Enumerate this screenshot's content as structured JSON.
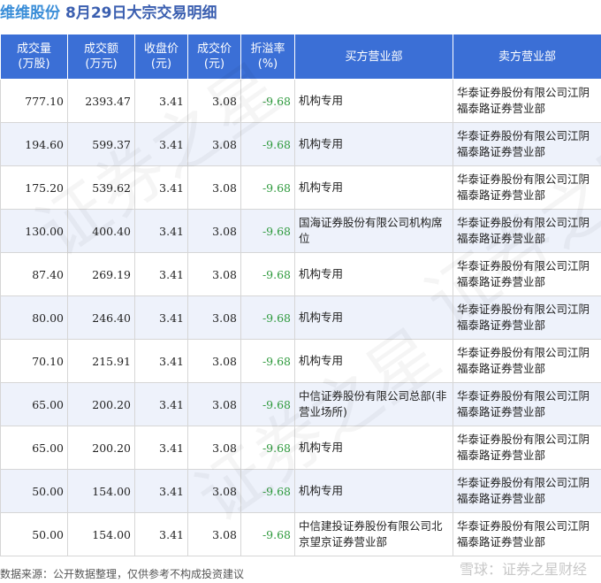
{
  "header": {
    "stock_name": "维维股份",
    "subtitle": "8月29日大宗交易明细"
  },
  "table": {
    "headers": {
      "volume": [
        "成交量",
        "(万股)"
      ],
      "amount": [
        "成交额",
        "(万元)"
      ],
      "close": [
        "收盘价",
        "(元)"
      ],
      "price": [
        "成交价",
        "(元)"
      ],
      "premium": [
        "折溢率",
        "(%)"
      ],
      "buyer": "买方营业部",
      "seller": "卖方营业部"
    },
    "rows": [
      {
        "volume": "777.10",
        "amount": "2393.47",
        "close": "3.41",
        "price": "3.08",
        "premium": "-9.68",
        "buyer": "机构专用",
        "seller": "华泰证券股份有限公司江阴福泰路证券营业部"
      },
      {
        "volume": "194.60",
        "amount": "599.37",
        "close": "3.41",
        "price": "3.08",
        "premium": "-9.68",
        "buyer": "机构专用",
        "seller": "华泰证券股份有限公司江阴福泰路证券营业部"
      },
      {
        "volume": "175.20",
        "amount": "539.62",
        "close": "3.41",
        "price": "3.08",
        "premium": "-9.68",
        "buyer": "机构专用",
        "seller": "华泰证券股份有限公司江阴福泰路证券营业部"
      },
      {
        "volume": "130.00",
        "amount": "400.40",
        "close": "3.41",
        "price": "3.08",
        "premium": "-9.68",
        "buyer": "国海证券股份有限公司机构席位",
        "seller": "华泰证券股份有限公司江阴福泰路证券营业部"
      },
      {
        "volume": "87.40",
        "amount": "269.19",
        "close": "3.41",
        "price": "3.08",
        "premium": "-9.68",
        "buyer": "机构专用",
        "seller": "华泰证券股份有限公司江阴福泰路证券营业部"
      },
      {
        "volume": "80.00",
        "amount": "246.40",
        "close": "3.41",
        "price": "3.08",
        "premium": "-9.68",
        "buyer": "机构专用",
        "seller": "华泰证券股份有限公司江阴福泰路证券营业部"
      },
      {
        "volume": "70.10",
        "amount": "215.91",
        "close": "3.41",
        "price": "3.08",
        "premium": "-9.68",
        "buyer": "机构专用",
        "seller": "华泰证券股份有限公司江阴福泰路证券营业部"
      },
      {
        "volume": "65.00",
        "amount": "200.20",
        "close": "3.41",
        "price": "3.08",
        "premium": "-9.68",
        "buyer": "中信证券股份有限公司总部(非营业场所)",
        "seller": "华泰证券股份有限公司江阴福泰路证券营业部"
      },
      {
        "volume": "65.00",
        "amount": "200.20",
        "close": "3.41",
        "price": "3.08",
        "premium": "-9.68",
        "buyer": "机构专用",
        "seller": "华泰证券股份有限公司江阴福泰路证券营业部"
      },
      {
        "volume": "50.00",
        "amount": "154.00",
        "close": "3.41",
        "price": "3.08",
        "premium": "-9.68",
        "buyer": "机构专用",
        "seller": "华泰证券股份有限公司江阴福泰路证券营业部"
      },
      {
        "volume": "50.00",
        "amount": "154.00",
        "close": "3.41",
        "price": "3.08",
        "premium": "-9.68",
        "buyer": "中信建投证券股份有限公司北京望京证券营业部",
        "seller": "华泰证券股份有限公司江阴福泰路证券营业部"
      }
    ]
  },
  "footer": {
    "source_note": "数据来源：公开数据整理，仅供参考不构成投资建议",
    "brand": "雪球：证券之星财经"
  },
  "watermark": "证券之星",
  "colors": {
    "header_bg": "#3b6fd6",
    "stock_name": "#3a8ed8",
    "negative": "#2e9a3d",
    "row_alt": "#eef2fb"
  }
}
